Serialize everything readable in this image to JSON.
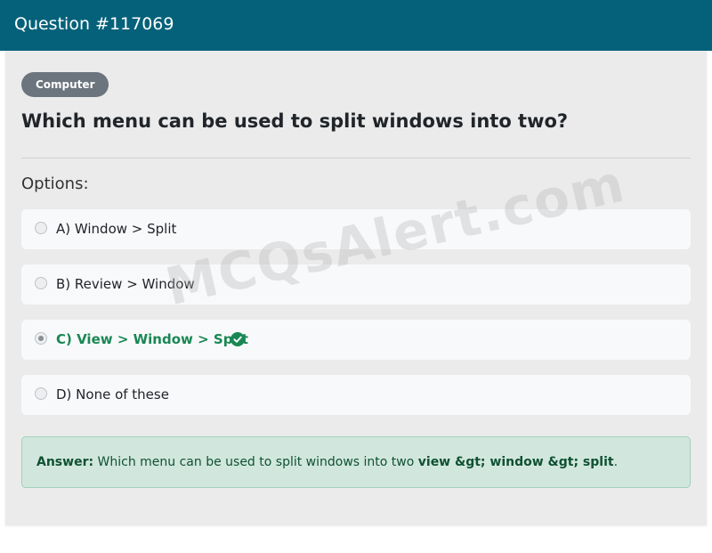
{
  "header": {
    "title": "Question #117069"
  },
  "category": "Computer",
  "question": "Which menu can be used to split windows into two?",
  "options_label": "Options:",
  "options": [
    {
      "label": "A) Window > Split",
      "selected": false,
      "correct": false
    },
    {
      "label": "B) Review > Window",
      "selected": false,
      "correct": false
    },
    {
      "label": "C) View > Window > Split",
      "selected": true,
      "correct": true
    },
    {
      "label": "D) None of these",
      "selected": false,
      "correct": false
    }
  ],
  "answer": {
    "prefix": "Answer:",
    "text": " Which menu can be used to split windows into two ",
    "value": "view &gt; window &gt; split",
    "suffix": "."
  },
  "watermark": "MCQsAlert.com",
  "colors": {
    "header": "#05617a",
    "correct": "#198754",
    "answer_bg": "#d1e7dd"
  }
}
